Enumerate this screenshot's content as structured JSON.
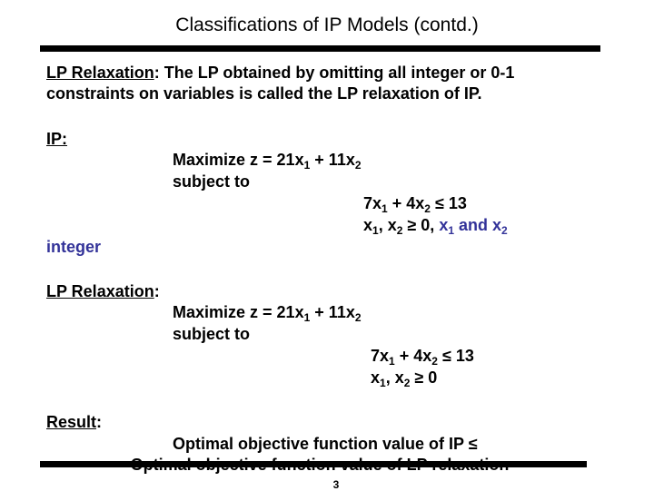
{
  "slide": {
    "title": "Classifications of IP Models (contd.)",
    "page_number": "3"
  },
  "definition": {
    "term": "LP Relaxation",
    "colon": ":",
    "text_line1": " The LP obtained by omitting all integer or 0-1",
    "text_line2": "constraints on variables is called the LP relaxation of IP."
  },
  "ip_model": {
    "heading": "IP:",
    "objective_prefix": "Maximize   z = 21x",
    "objective_sub1": "1",
    "objective_mid": " + 11x",
    "objective_sub2": "2",
    "subject_to": "subject to",
    "constraint1_a": "7x",
    "constraint1_sub1": "1",
    "constraint1_b": " + 4x",
    "constraint1_sub2": "2",
    "constraint1_c": " ≤ 13",
    "constraint2_a": "x",
    "constraint2_sub1": "1",
    "constraint2_b": ", x",
    "constraint2_sub2": "2",
    "constraint2_c": " ≥ 0, ",
    "integer_a": "x",
    "integer_sub1": "1",
    "integer_b": " and x",
    "integer_sub2": "2",
    "integer_word": "integer"
  },
  "lp_model": {
    "heading": "LP Relaxation",
    "colon": ":",
    "objective_prefix": "Maximize   z = 21x",
    "objective_sub1": "1",
    "objective_mid": " + 11x",
    "objective_sub2": "2",
    "subject_to": "subject to",
    "constraint1_a": "7x",
    "constraint1_sub1": "1",
    "constraint1_b": " + 4x",
    "constraint1_sub2": "2",
    "constraint1_c": " ≤ 13",
    "constraint2_a": "x",
    "constraint2_sub1": "1",
    "constraint2_b": ", x",
    "constraint2_sub2": "2",
    "constraint2_c": " ≥ 0"
  },
  "result": {
    "heading": "Result",
    "colon": ":",
    "line1": "Optimal objective function value of IP ≤",
    "line2": "Optimal objective function value of LP relaxation"
  },
  "colors": {
    "text": "#000000",
    "accent_blue": "#333399"
  }
}
